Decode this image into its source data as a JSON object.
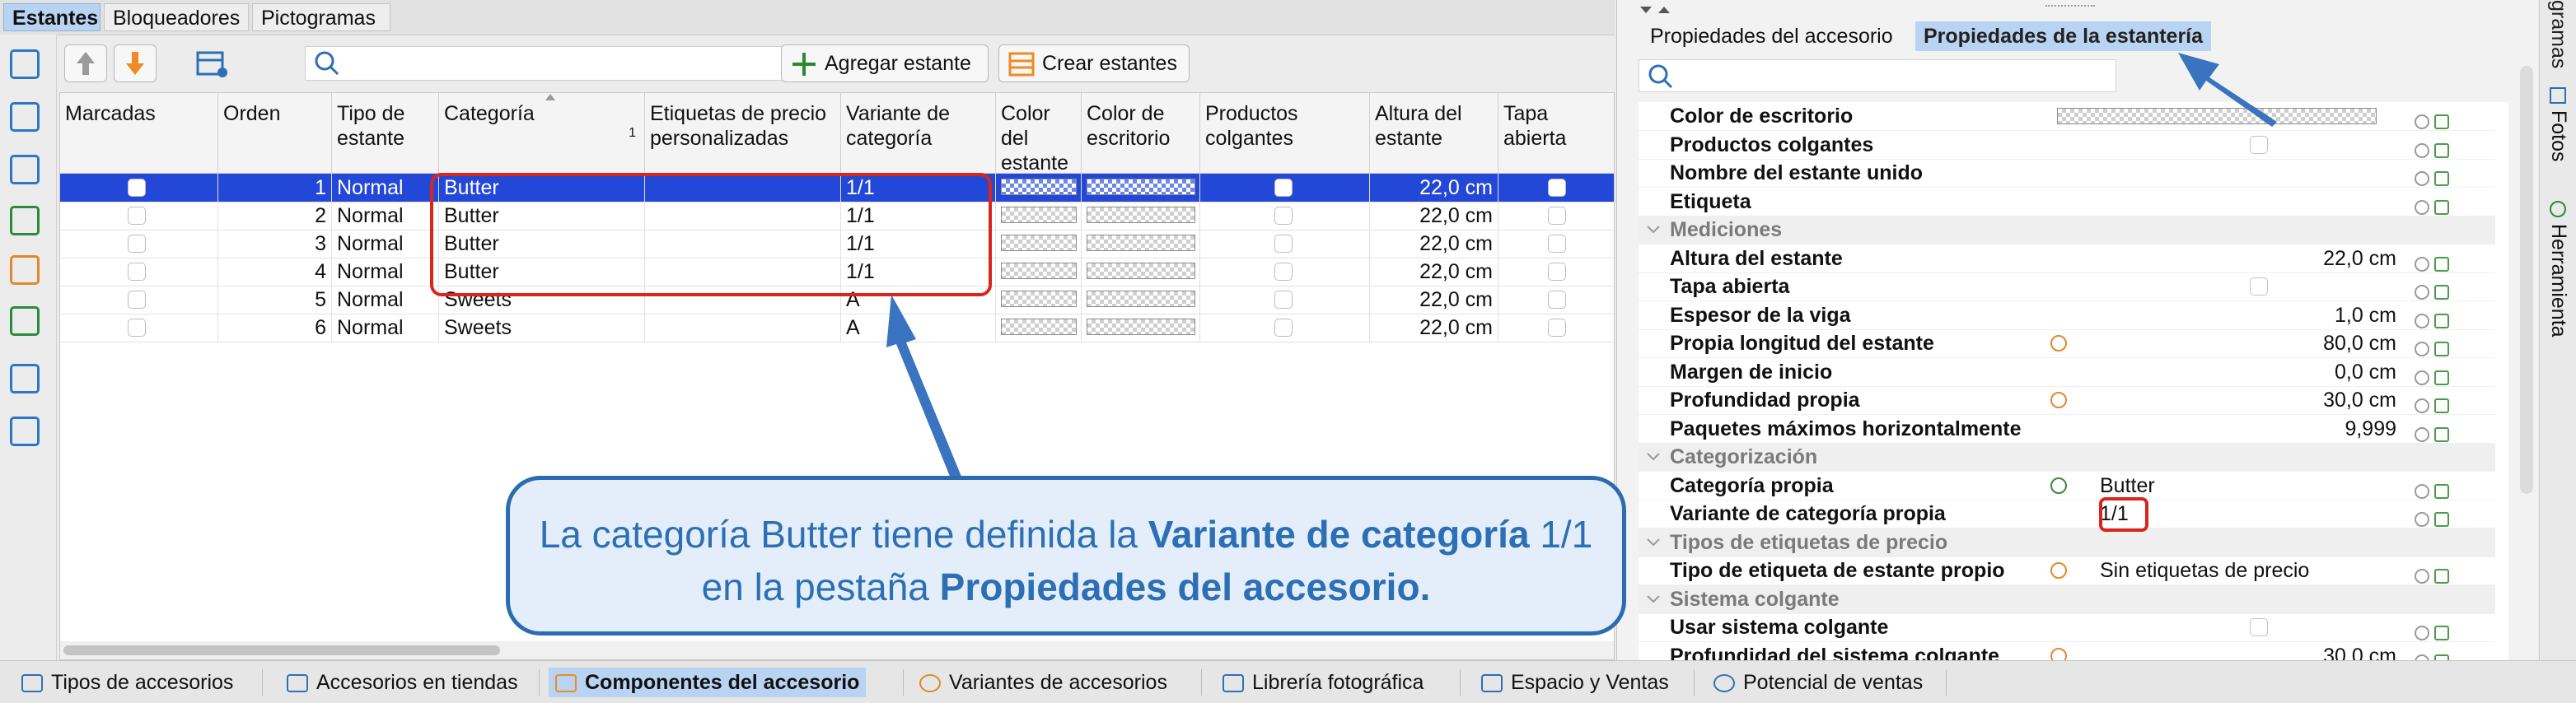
{
  "top_tabs": [
    "Estantes",
    "Bloqueadores",
    "Pictogramas"
  ],
  "toolbar": {
    "add_shelf_label": "Agregar estante",
    "create_shelves_label": "Crear estantes",
    "search_placeholder": ""
  },
  "grid": {
    "columns": [
      "Marcadas",
      "Orden",
      "Tipo de estante",
      "Categoría",
      "Etiquetas de precio personalizadas",
      "Variante de categoría",
      "Color del estante",
      "Color de escritorio",
      "Productos colgantes",
      "Altura del estante",
      "Tapa abierta"
    ],
    "sort_indicator": "1",
    "rows": [
      {
        "orden": "1",
        "tipo": "Normal",
        "categoria": "Butter",
        "variante": "1/1",
        "altura": "22,0 cm"
      },
      {
        "orden": "2",
        "tipo": "Normal",
        "categoria": "Butter",
        "variante": "1/1",
        "altura": "22,0 cm"
      },
      {
        "orden": "3",
        "tipo": "Normal",
        "categoria": "Butter",
        "variante": "1/1",
        "altura": "22,0 cm"
      },
      {
        "orden": "4",
        "tipo": "Normal",
        "categoria": "Butter",
        "variante": "1/1",
        "altura": "22,0 cm"
      },
      {
        "orden": "5",
        "tipo": "Normal",
        "categoria": "Sweets",
        "variante": "A",
        "altura": "22,0 cm"
      },
      {
        "orden": "6",
        "tipo": "Normal",
        "categoria": "Sweets",
        "variante": "A",
        "altura": "22,0 cm"
      }
    ]
  },
  "right_panel": {
    "tabs": [
      "Propiedades del accesorio",
      "Propiedades de la estantería"
    ],
    "search_placeholder": "",
    "properties": [
      {
        "name": "Color de escritorio",
        "kind": "swatch"
      },
      {
        "name": "Productos colgantes",
        "kind": "check"
      },
      {
        "name": "Nombre del estante unido",
        "value": ""
      },
      {
        "name": "Etiqueta",
        "value": ""
      },
      {
        "section": "Mediciones"
      },
      {
        "name": "Altura del estante",
        "value": "22,0 cm"
      },
      {
        "name": "Tapa abierta",
        "kind": "check"
      },
      {
        "name": "Espesor de la viga",
        "value": "1,0 cm"
      },
      {
        "name": "Propia longitud del estante",
        "value": "80,0 cm",
        "mark": "orange"
      },
      {
        "name": "Margen de inicio",
        "value": "0,0 cm"
      },
      {
        "name": "Profundidad propia",
        "value": "30,0 cm",
        "mark": "orange"
      },
      {
        "name": "Paquetes máximos horizontalmente",
        "value": "9,999"
      },
      {
        "section": "Categorización"
      },
      {
        "name": "Categoría propia",
        "value_left": "Butter",
        "mark": "green"
      },
      {
        "name": "Variante de categoría propia",
        "value_left": "1/1"
      },
      {
        "section": "Tipos de etiquetas de precio"
      },
      {
        "name": "Tipo de etiqueta de estante propio",
        "value_left": "Sin etiquetas de precio",
        "mark": "orange"
      },
      {
        "section": "Sistema colgante"
      },
      {
        "name": "Usar sistema colgante",
        "kind": "check"
      },
      {
        "name": "Profundidad del sistema colgante",
        "value": "30,0 cm",
        "mark": "orange"
      }
    ]
  },
  "side_tabs": [
    "gramas",
    "Fotos",
    "Herramienta"
  ],
  "bottom_tabs": [
    "Tipos de accesorios",
    "Accesorios en tiendas",
    "Componentes del accesorio",
    "Variantes de accesorios",
    "Librería fotográfica",
    "Espacio y Ventas",
    "Potencial de ventas"
  ],
  "callout": {
    "part1": "La categoría Butter tiene definida la ",
    "bold1": "Variante de categoría",
    "part2": " 1/1 en la pestaña ",
    "bold2": "Propiedades del accesorio."
  },
  "colors": {
    "selection": "#2348d8",
    "tab_active": "#b9d3f2",
    "callout_border": "#2b6cb0",
    "highlight_red": "#d9261c"
  }
}
